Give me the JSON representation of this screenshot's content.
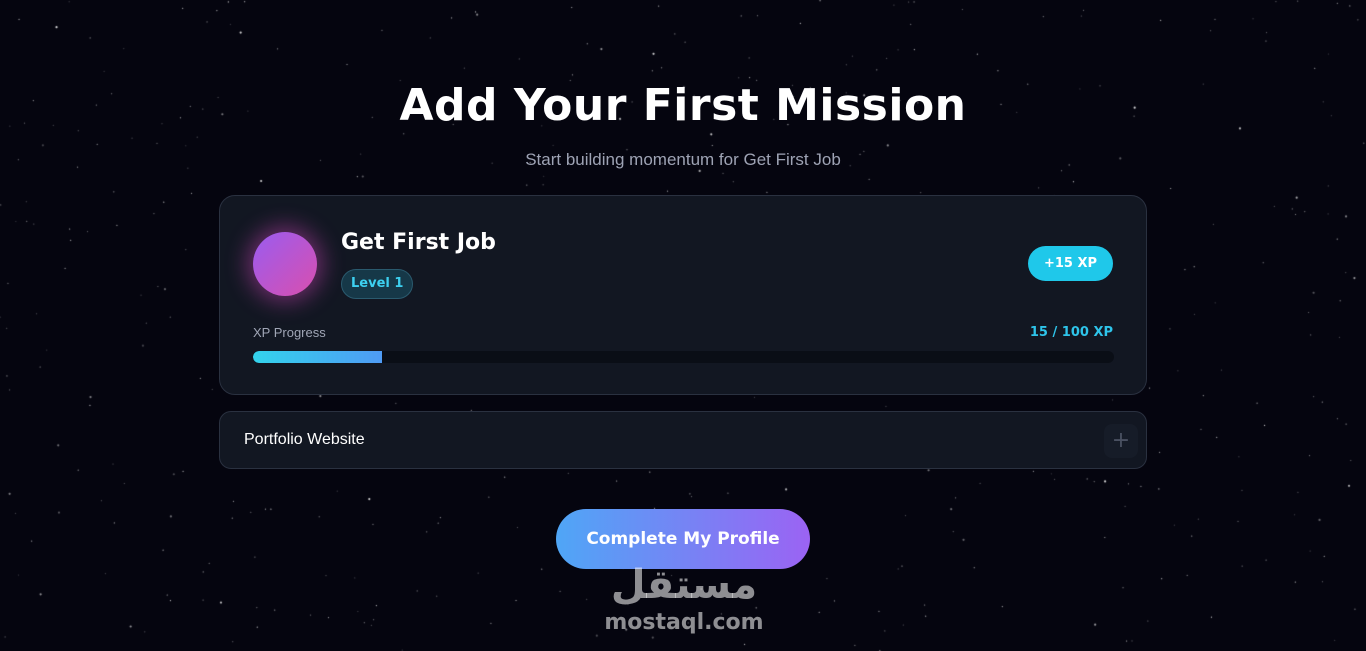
{
  "header": {
    "title": "Add Your First Mission",
    "subtitle": "Start building momentum for Get First Job"
  },
  "goal_card": {
    "title": "Get First Job",
    "level": "Level 1",
    "xp_reward": "+15 XP",
    "progress_label": "XP Progress",
    "progress_text": "15 / 100 XP",
    "progress_fraction": 0.15
  },
  "missions": [
    {
      "label": "Portfolio Website",
      "action": "+"
    }
  ],
  "cta": {
    "label": "Complete My Profile"
  },
  "watermark": {
    "logo": "مستقل",
    "url": "mostaql.com"
  },
  "colors": {
    "background": "#05050f",
    "card": "#121722",
    "accent_cyan": "#1fc8ea",
    "accent_purple": "#9b63f3"
  }
}
